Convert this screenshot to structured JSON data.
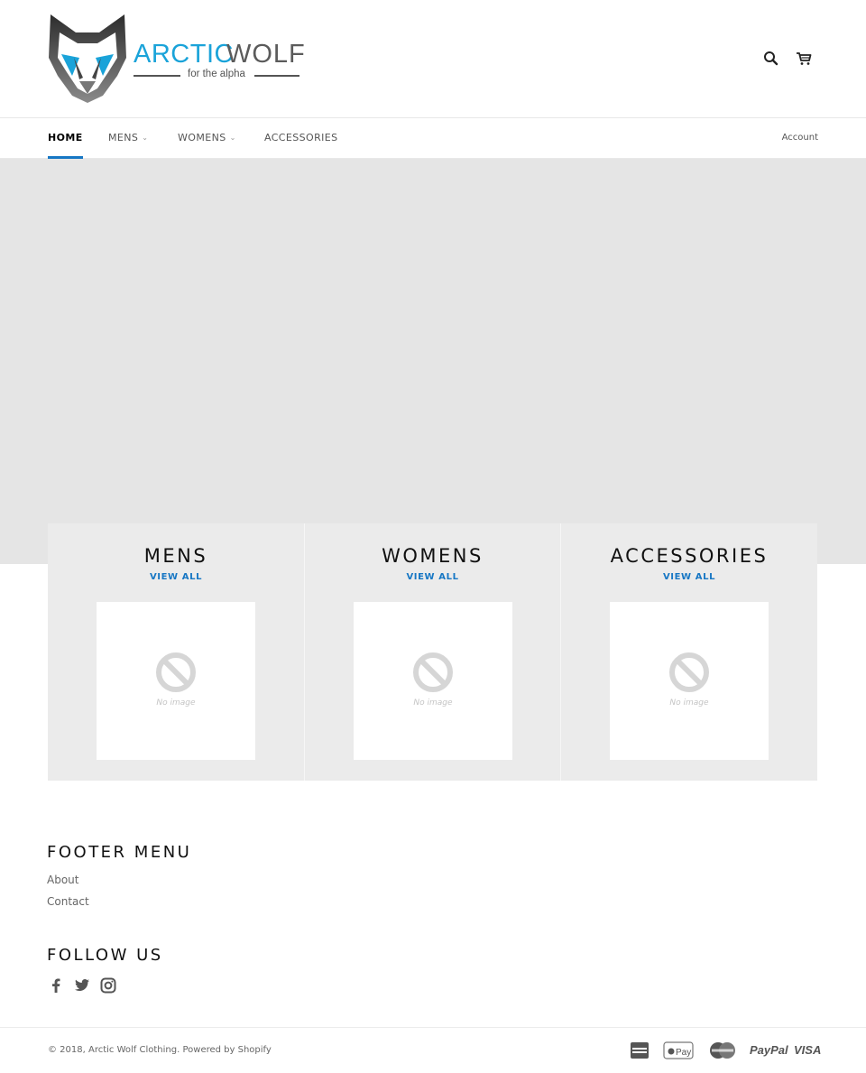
{
  "header": {
    "logo": {
      "word1": "ARCTIC",
      "word2": "WOLF",
      "tagline": "for the alpha"
    },
    "icons": [
      "search-icon",
      "cart-icon"
    ]
  },
  "nav": {
    "items": [
      {
        "label": "HOME",
        "active": true,
        "dropdown": false
      },
      {
        "label": "MENS",
        "active": false,
        "dropdown": true
      },
      {
        "label": "WOMENS",
        "active": false,
        "dropdown": true
      },
      {
        "label": "ACCESSORIES",
        "active": false,
        "dropdown": false
      }
    ],
    "account": "Account"
  },
  "collections": [
    {
      "title": "MENS",
      "link": "VIEW ALL",
      "image_text": "No image"
    },
    {
      "title": "WOMENS",
      "link": "VIEW ALL",
      "image_text": "No image"
    },
    {
      "title": "ACCESSORIES",
      "link": "VIEW ALL",
      "image_text": "No image"
    }
  ],
  "footer": {
    "menu_title": "FOOTER MENU",
    "menu_links": [
      "About",
      "Contact"
    ],
    "follow_title": "FOLLOW US",
    "social_icons": [
      "facebook-icon",
      "twitter-icon",
      "instagram-icon"
    ],
    "copyright_prefix": "© 2018, ",
    "store_name": "Arctic Wolf Clothing",
    "powered_by": ". Powered by Shopify",
    "payment_icons": [
      "american-express-icon",
      "apple-pay-icon",
      "mastercard-icon",
      "paypal-icon",
      "visa-icon"
    ],
    "payment_labels": {
      "paypal": "PayPal",
      "visa": "VISA"
    }
  },
  "colors": {
    "accent": "#1777c4",
    "logo_blue": "#1aa3d9",
    "hero_bg": "#e5e5e5",
    "card_bg": "#ebebeb"
  }
}
